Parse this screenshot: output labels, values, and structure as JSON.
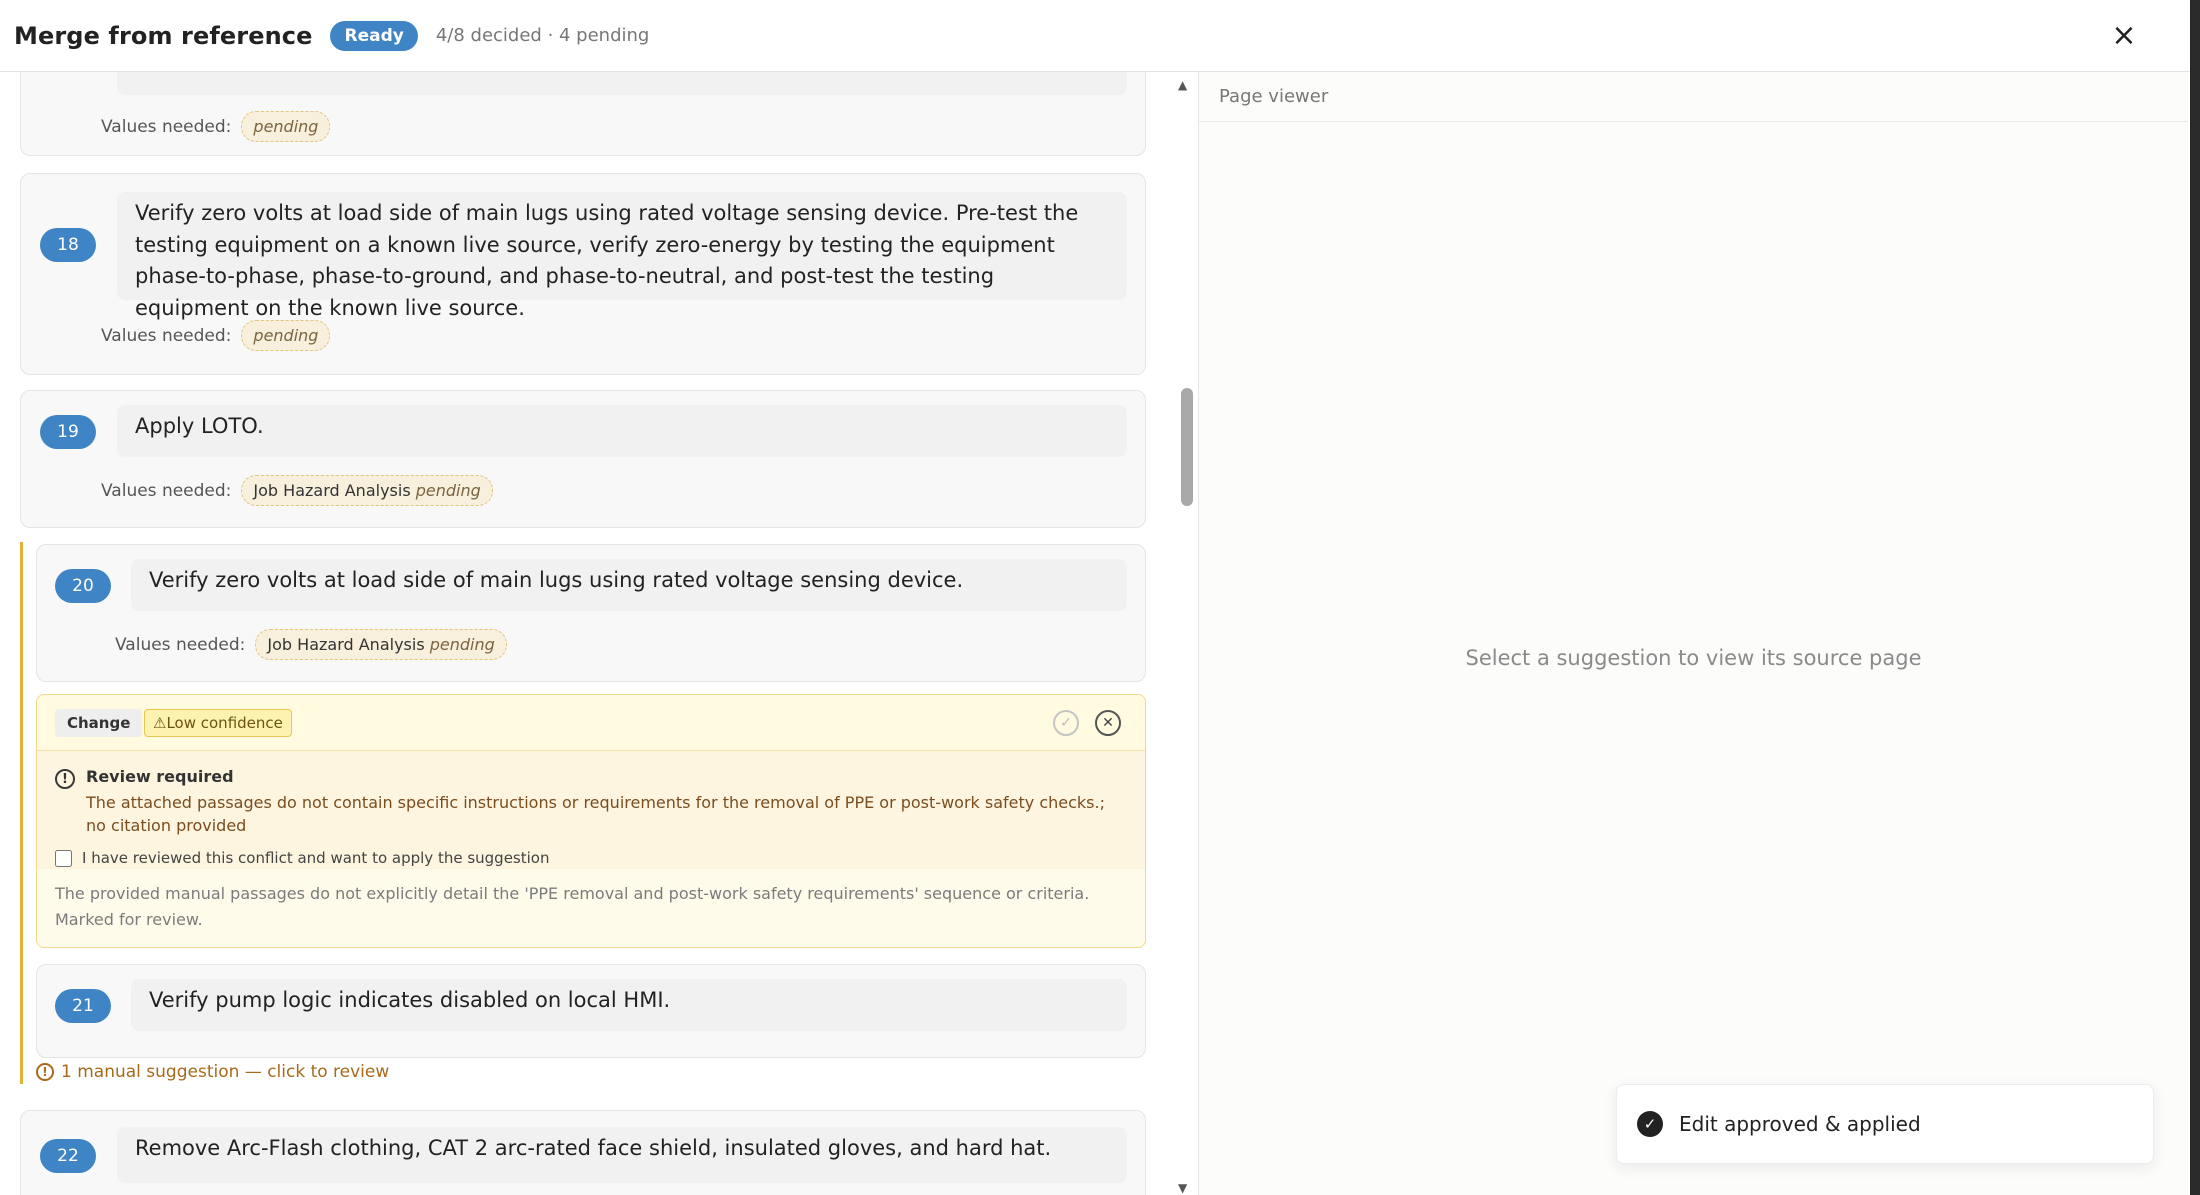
{
  "header": {
    "title": "Merge from reference",
    "status_badge": "Ready",
    "summary": "4/8 decided · 4 pending",
    "close_icon": "×"
  },
  "values_label": "Values needed:",
  "steps": [
    {
      "number": "",
      "text": "",
      "values": [
        {
          "name": "",
          "status": "pending"
        }
      ]
    },
    {
      "number": "18",
      "text": "Verify zero volts at load side of main lugs using rated voltage sensing device. Pre-test the testing equipment on a known live source, verify zero-energy by testing the equipment phase-to-phase, phase-to-ground, and phase-to-neutral, and post-test the testing equipment on the known live source.",
      "values": [
        {
          "name": "",
          "status": "pending"
        }
      ]
    },
    {
      "number": "19",
      "text": "Apply LOTO.",
      "values": [
        {
          "name": "Job Hazard Analysis",
          "status": "pending"
        }
      ]
    },
    {
      "number": "20",
      "text": "Verify zero volts at load side of main lugs using rated voltage sensing device.",
      "values": [
        {
          "name": "Job Hazard Analysis",
          "status": "pending"
        }
      ]
    },
    {
      "number": "21",
      "text": "Verify pump logic indicates disabled on local HMI."
    },
    {
      "number": "22",
      "text": "Remove Arc-Flash clothing, CAT 2 arc-rated face shield, insulated gloves, and hard hat."
    }
  ],
  "suggestion": {
    "type_label": "Change",
    "confidence_label": "Low confidence",
    "review_title": "Review required",
    "review_body": "The attached passages do not contain specific instructions or requirements for the removal of PPE or post-work safety checks.; no citation provided",
    "checkbox_label": "I have reviewed this conflict and want to apply the suggestion",
    "note": "The provided manual passages do not explicitly detail the 'PPE removal and post-work safety requirements' sequence or criteria. Marked for review."
  },
  "manual_suggestion": "1 manual suggestion — click to review",
  "page_viewer": {
    "title": "Page viewer",
    "empty_text": "Select a suggestion to view its source page"
  },
  "toast": {
    "message": "Edit approved & applied"
  },
  "colors": {
    "accent": "#3f84c4",
    "warning": "#e0b23a",
    "warning_text": "#a86a1a"
  }
}
